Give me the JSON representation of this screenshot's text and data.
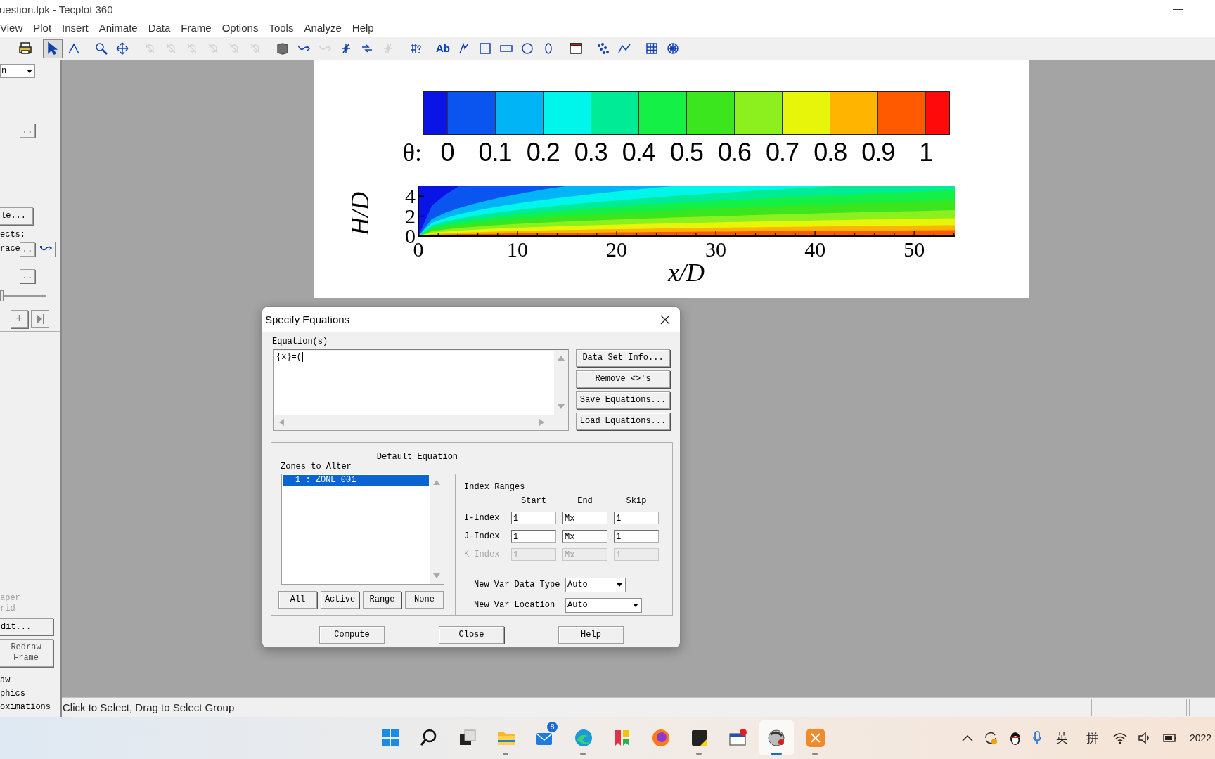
{
  "window": {
    "title": "uestion.lpk - Tecplot 360"
  },
  "menu": [
    "View",
    "Plot",
    "Insert",
    "Animate",
    "Data",
    "Frame",
    "Options",
    "Tools",
    "Analyze",
    "Help"
  ],
  "toolbar": {
    "groups": [
      {
        "buttons": [
          {
            "kind": "print",
            "selected": false,
            "disabled": false
          }
        ]
      },
      {
        "buttons": [
          {
            "kind": "pointer",
            "selected": true,
            "disabled": false
          },
          {
            "kind": "adjustor",
            "selected": false,
            "disabled": false
          }
        ]
      },
      {
        "buttons": [
          {
            "kind": "zoom",
            "selected": false,
            "disabled": false
          },
          {
            "kind": "pan",
            "selected": false,
            "disabled": false
          }
        ]
      },
      {
        "buttons": [
          {
            "kind": "rotate",
            "selected": false,
            "disabled": true
          },
          {
            "kind": "rotate",
            "selected": false,
            "disabled": true
          },
          {
            "kind": "rotate",
            "selected": false,
            "disabled": true
          },
          {
            "kind": "rotate",
            "selected": false,
            "disabled": true
          },
          {
            "kind": "rotate",
            "selected": false,
            "disabled": true
          },
          {
            "kind": "rotate",
            "selected": false,
            "disabled": true
          }
        ]
      },
      {
        "buttons": [
          {
            "kind": "block",
            "selected": false,
            "disabled": false
          },
          {
            "kind": "stream",
            "selected": false,
            "disabled": false
          },
          {
            "kind": "stream",
            "selected": false,
            "disabled": true
          },
          {
            "kind": "probe",
            "selected": false,
            "disabled": false
          },
          {
            "kind": "slice",
            "selected": false,
            "disabled": false
          },
          {
            "kind": "probe",
            "selected": false,
            "disabled": true
          }
        ]
      },
      {
        "buttons": [
          {
            "kind": "query",
            "selected": false,
            "disabled": false
          }
        ]
      },
      {
        "buttons": [
          {
            "kind": "text",
            "label": "Ab",
            "selected": false,
            "disabled": false
          },
          {
            "kind": "polyline",
            "selected": false,
            "disabled": false
          },
          {
            "kind": "square",
            "selected": false,
            "disabled": false
          },
          {
            "kind": "rect",
            "selected": false,
            "disabled": false
          },
          {
            "kind": "circle",
            "selected": false,
            "disabled": false
          },
          {
            "kind": "ellipse",
            "selected": false,
            "disabled": false
          }
        ]
      },
      {
        "buttons": [
          {
            "kind": "frame",
            "selected": false,
            "disabled": false
          }
        ]
      },
      {
        "buttons": [
          {
            "kind": "scatter",
            "selected": false,
            "disabled": false
          },
          {
            "kind": "xyline",
            "selected": false,
            "disabled": false
          }
        ]
      },
      {
        "buttons": [
          {
            "kind": "grid",
            "selected": false,
            "disabled": false
          },
          {
            "kind": "polar",
            "selected": false,
            "disabled": false
          }
        ]
      }
    ]
  },
  "sidebar": {
    "plot_mode": "n",
    "zone_button": "..",
    "style_button": "le...",
    "effects_label": "ects:",
    "trace_label": "race",
    "trace_button": "..",
    "slice_button": "..",
    "slider": {
      "level": 0
    },
    "add_button": "+",
    "options": [
      {
        "text": "aper",
        "disabled": true
      },
      {
        "text": "rid",
        "disabled": true
      }
    ],
    "edit_button": "dit...",
    "redraw_button": "Redraw Frame",
    "notes": [
      "aw",
      "phics",
      "oximations"
    ]
  },
  "plot": {
    "legend": {
      "symbol": "θ:",
      "labels": [
        "0",
        "0.1",
        "0.2",
        "0.3",
        "0.4",
        "0.5",
        "0.6",
        "0.7",
        "0.8",
        "0.9",
        "1"
      ],
      "swatches": [
        {
          "color": "#0a14e6"
        },
        {
          "color": "#0a55f0"
        },
        {
          "color": "#00b4f5"
        },
        {
          "color": "#00f5eb"
        },
        {
          "color": "#00eb96"
        },
        {
          "color": "#14f046"
        },
        {
          "color": "#3ce61e"
        },
        {
          "color": "#8cf01e"
        },
        {
          "color": "#e6f50a"
        },
        {
          "color": "#ffb400"
        },
        {
          "color": "#ff5a00"
        },
        {
          "color": "#ff0a0a"
        }
      ]
    },
    "contour": {
      "y_label": "H/D",
      "x_label": "x/D",
      "y_ticks": [
        "4",
        "2",
        "0"
      ],
      "x_ticks": [
        "0",
        "10",
        "20",
        "30",
        "40",
        "50"
      ]
    }
  },
  "dialog": {
    "title": "Specify Equations",
    "equations_label": "Equation(s)",
    "equation": "{x}=(",
    "side_buttons": [
      "Data Set Info...",
      "Remove <>'s",
      "Save Equations...",
      "Load Equations..."
    ],
    "default_equation_label": "Default Equation",
    "zones_label": "Zones to Alter",
    "zones": [
      {
        "text": "1 : ZONE 001",
        "selected": true
      }
    ],
    "zone_buttons": [
      "All",
      "Active",
      "Range",
      "None"
    ],
    "index_ranges": {
      "title": "Index Ranges",
      "columns": [
        "Start",
        "End",
        "Skip"
      ],
      "rows": [
        {
          "label": "I-Index",
          "values": [
            "1",
            "Mx",
            "1"
          ],
          "disabled": false
        },
        {
          "label": "J-Index",
          "values": [
            "1",
            "Mx",
            "1"
          ],
          "disabled": false
        },
        {
          "label": "K-Index",
          "values": [
            "1",
            "Mx",
            "1"
          ],
          "disabled": true
        }
      ]
    },
    "data_type": {
      "label": "New Var Data Type",
      "value": "Auto"
    },
    "location": {
      "label": "New Var Location",
      "value": "Auto"
    },
    "buttons": [
      "Compute",
      "Close",
      "Help"
    ]
  },
  "status_bar": {
    "text": "Click to Select, Drag to Select Group"
  },
  "taskbar": {
    "apps": [
      {
        "kind": "start",
        "running": false,
        "active": false
      },
      {
        "kind": "search",
        "running": false,
        "active": false
      },
      {
        "kind": "taskview",
        "running": false,
        "active": false
      },
      {
        "kind": "folder",
        "running": true,
        "active": false
      },
      {
        "kind": "mail",
        "badge": "8",
        "running": false,
        "active": false
      },
      {
        "kind": "browser",
        "running": true,
        "active": false
      },
      {
        "kind": "bookmark",
        "running": false,
        "active": false
      },
      {
        "kind": "fox",
        "running": false,
        "active": false
      },
      {
        "kind": "note",
        "running": true,
        "active": false
      },
      {
        "kind": "window",
        "running": false,
        "active": false
      },
      {
        "kind": "tecplot",
        "running": true,
        "active": true
      },
      {
        "kind": "scissors",
        "running": true,
        "active": false
      }
    ],
    "tray": [
      "英",
      "拼"
    ],
    "clock": "2022"
  }
}
